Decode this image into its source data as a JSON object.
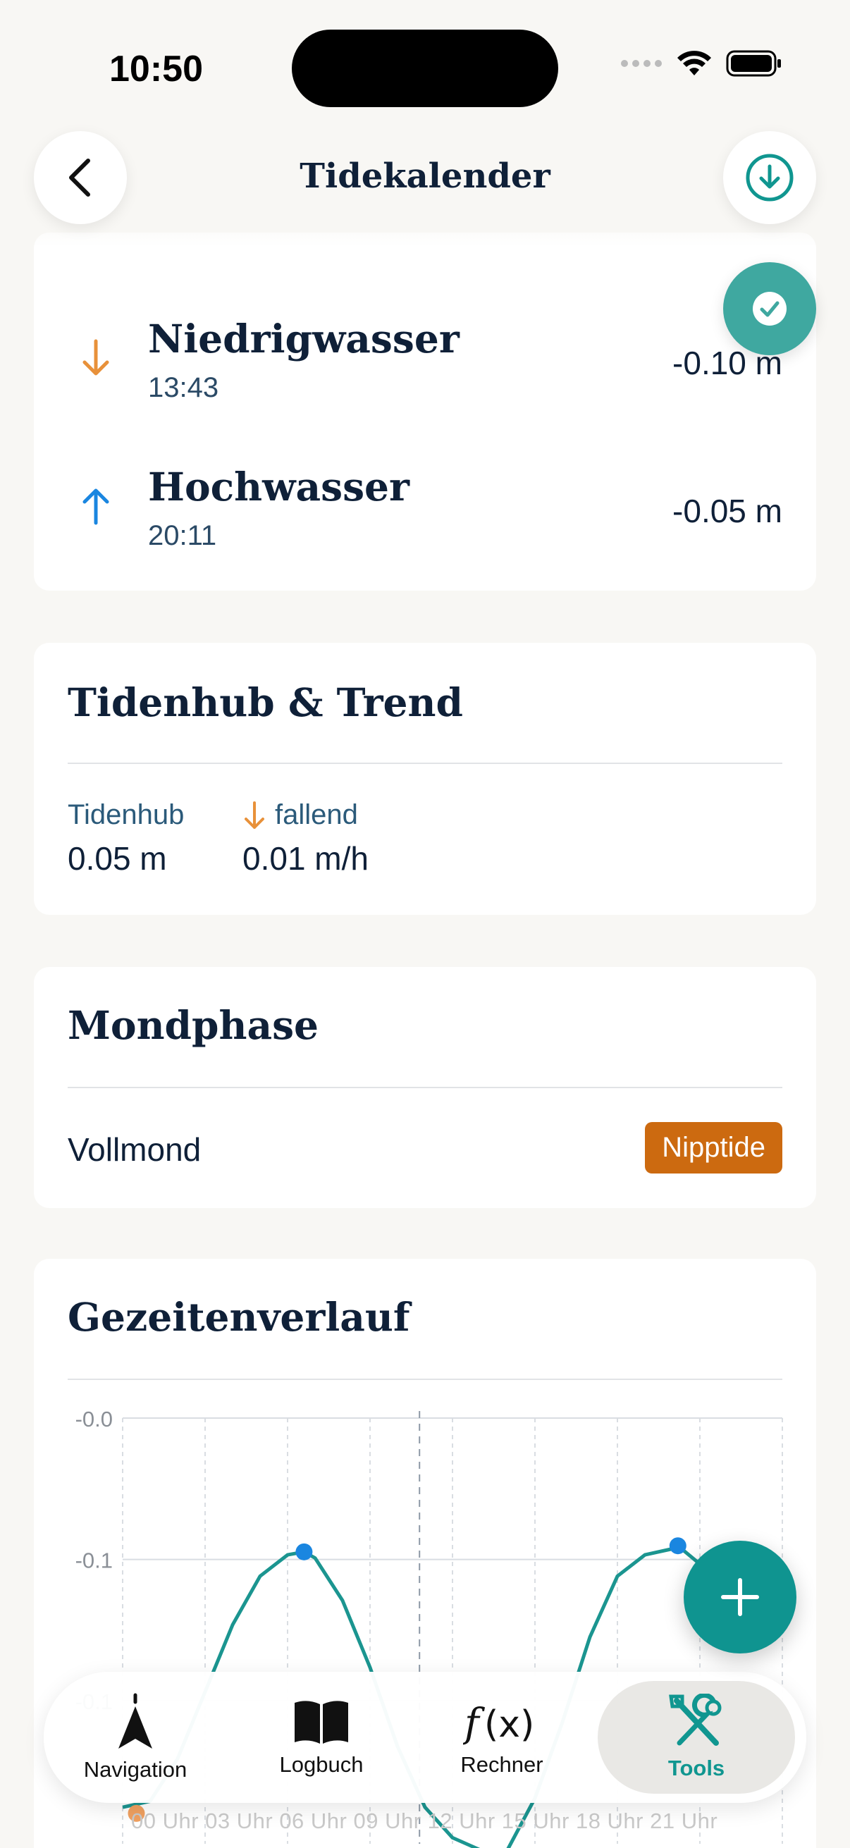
{
  "status": {
    "time": "10:50"
  },
  "header": {
    "title": "Tidekalender"
  },
  "tides": [
    {
      "label": "Niedrigwasser",
      "time": "13:43",
      "value": "-0.10 m",
      "direction": "down"
    },
    {
      "label": "Hochwasser",
      "time": "20:11",
      "value": "-0.05 m",
      "direction": "up"
    }
  ],
  "tidenhub": {
    "title": "Tidenhub & Trend",
    "hub_label": "Tidenhub",
    "hub_value": "0.05 m",
    "trend_label": "fallend",
    "trend_value": "0.01 m/h"
  },
  "mondphase": {
    "title": "Mondphase",
    "phase": "Vollmond",
    "badge": "Nipptide"
  },
  "chart_data": {
    "type": "line",
    "title": "Gezeitenverlauf",
    "y_tick_labels": [
      "-0.0",
      "-0.1",
      "-0.1"
    ],
    "x_tick_labels": [
      "00 Uhr",
      "03 Uhr",
      "06 Uhr",
      "09 Uhr",
      "12 Uhr",
      "15 Uhr",
      "18 Uhr",
      "21 Uhr"
    ],
    "now_hour": 10.8,
    "series": [
      {
        "x": [
          0,
          1,
          2,
          3,
          4,
          5,
          6,
          6.6,
          7,
          8,
          9,
          10,
          11,
          12,
          13,
          13.7,
          14,
          15,
          16,
          17,
          18,
          19,
          20,
          20.2,
          21,
          22
        ],
        "y": [
          -0.128,
          -0.126,
          -0.112,
          -0.09,
          -0.068,
          -0.052,
          -0.045,
          -0.044,
          -0.046,
          -0.06,
          -0.082,
          -0.108,
          -0.128,
          -0.138,
          -0.142,
          -0.144,
          -0.142,
          -0.125,
          -0.1,
          -0.072,
          -0.052,
          -0.045,
          -0.043,
          -0.042,
          -0.048,
          -0.07
        ]
      }
    ],
    "markers": [
      {
        "x": 0.5,
        "y": -0.13,
        "kind": "low",
        "color": "#f0a060"
      },
      {
        "x": 6.6,
        "y": -0.044,
        "kind": "high",
        "color": "#1a86e0"
      },
      {
        "x": 20.2,
        "y": -0.042,
        "kind": "high",
        "color": "#1a86e0"
      }
    ],
    "ylim": [
      -0.14,
      -0.0
    ],
    "xlim": [
      0,
      24
    ],
    "grid": true,
    "colors": {
      "line": "#1b9590",
      "grid": "#d9dde2"
    }
  },
  "tabbar": {
    "items": [
      {
        "label": "Navigation",
        "icon": "navigation-arrow-icon"
      },
      {
        "label": "Logbuch",
        "icon": "book-icon"
      },
      {
        "label": "Rechner",
        "icon": "function-icon"
      },
      {
        "label": "Tools",
        "icon": "tools-icon"
      }
    ],
    "active": "Tools"
  },
  "colors": {
    "accent": "#0f9490",
    "badge": "#cc6a10",
    "down_arrow": "#e8913a",
    "up_arrow": "#1a86e0"
  }
}
